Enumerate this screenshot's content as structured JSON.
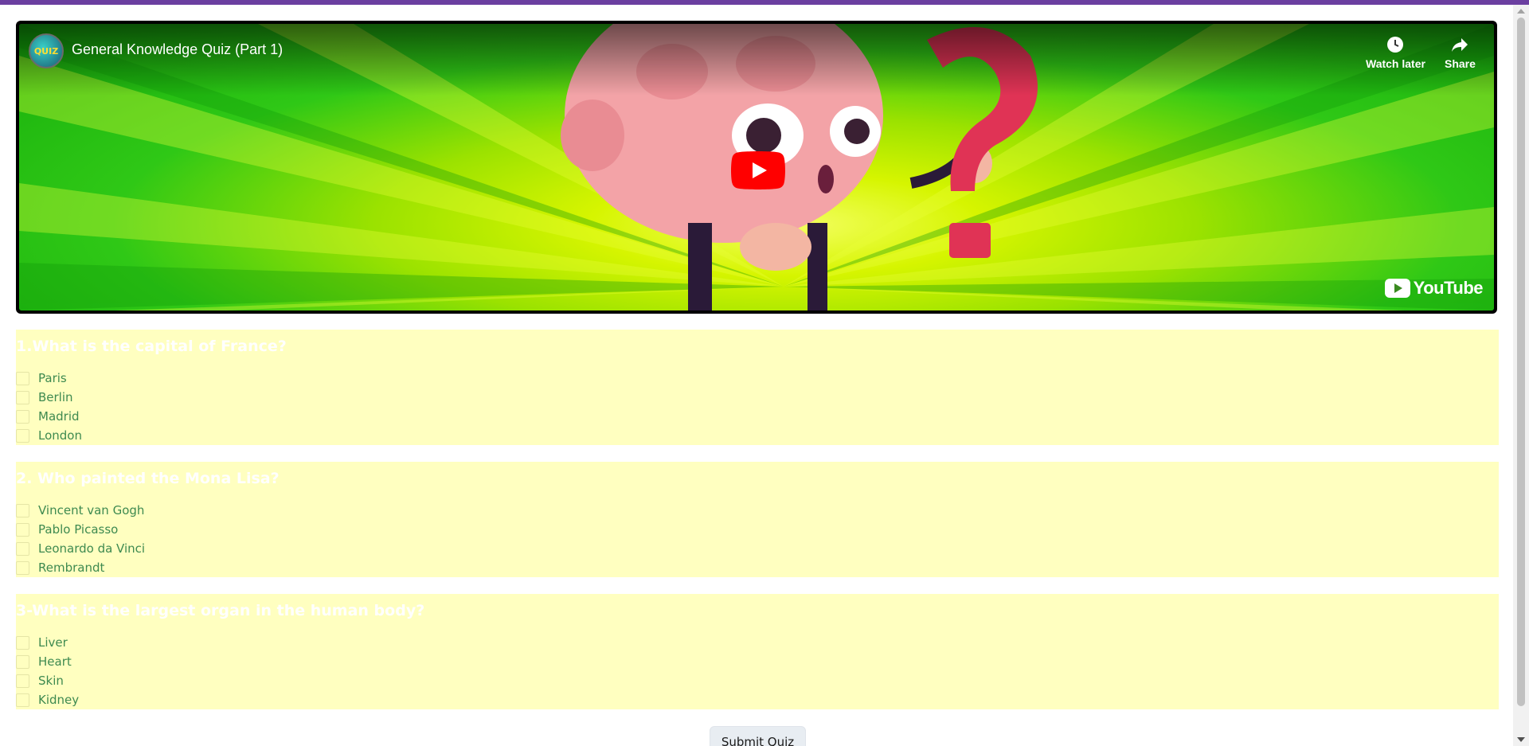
{
  "video": {
    "title": "General Knowledge Quiz (Part 1)",
    "channel_avatar_text": "QUIZ",
    "watch_later_label": "Watch later",
    "share_label": "Share",
    "logo_text": "YouTube",
    "play_icon": "play-icon",
    "watch_later_icon": "clock-icon",
    "share_icon": "share-arrow-icon"
  },
  "questions": [
    {
      "title": "1.What is the capital of France?",
      "options": [
        "Paris",
        "Berlin",
        "Madrid",
        "London"
      ]
    },
    {
      "title": "2. Who painted the Mona Lisa?",
      "options": [
        "Vincent van Gogh",
        "Pablo Picasso",
        "Leonardo da Vinci",
        "Rembrandt"
      ]
    },
    {
      "title": "3-What is the largest organ in the human body?",
      "options": [
        "Liver",
        "Heart",
        "Skin",
        "Kidney"
      ]
    }
  ],
  "submit_label": "Submit Quiz",
  "colors": {
    "top_bar": "#6b3fa0",
    "question_bg": "#ffffc0",
    "option_text": "#3e8a50",
    "youtube_red": "#ff0000"
  }
}
